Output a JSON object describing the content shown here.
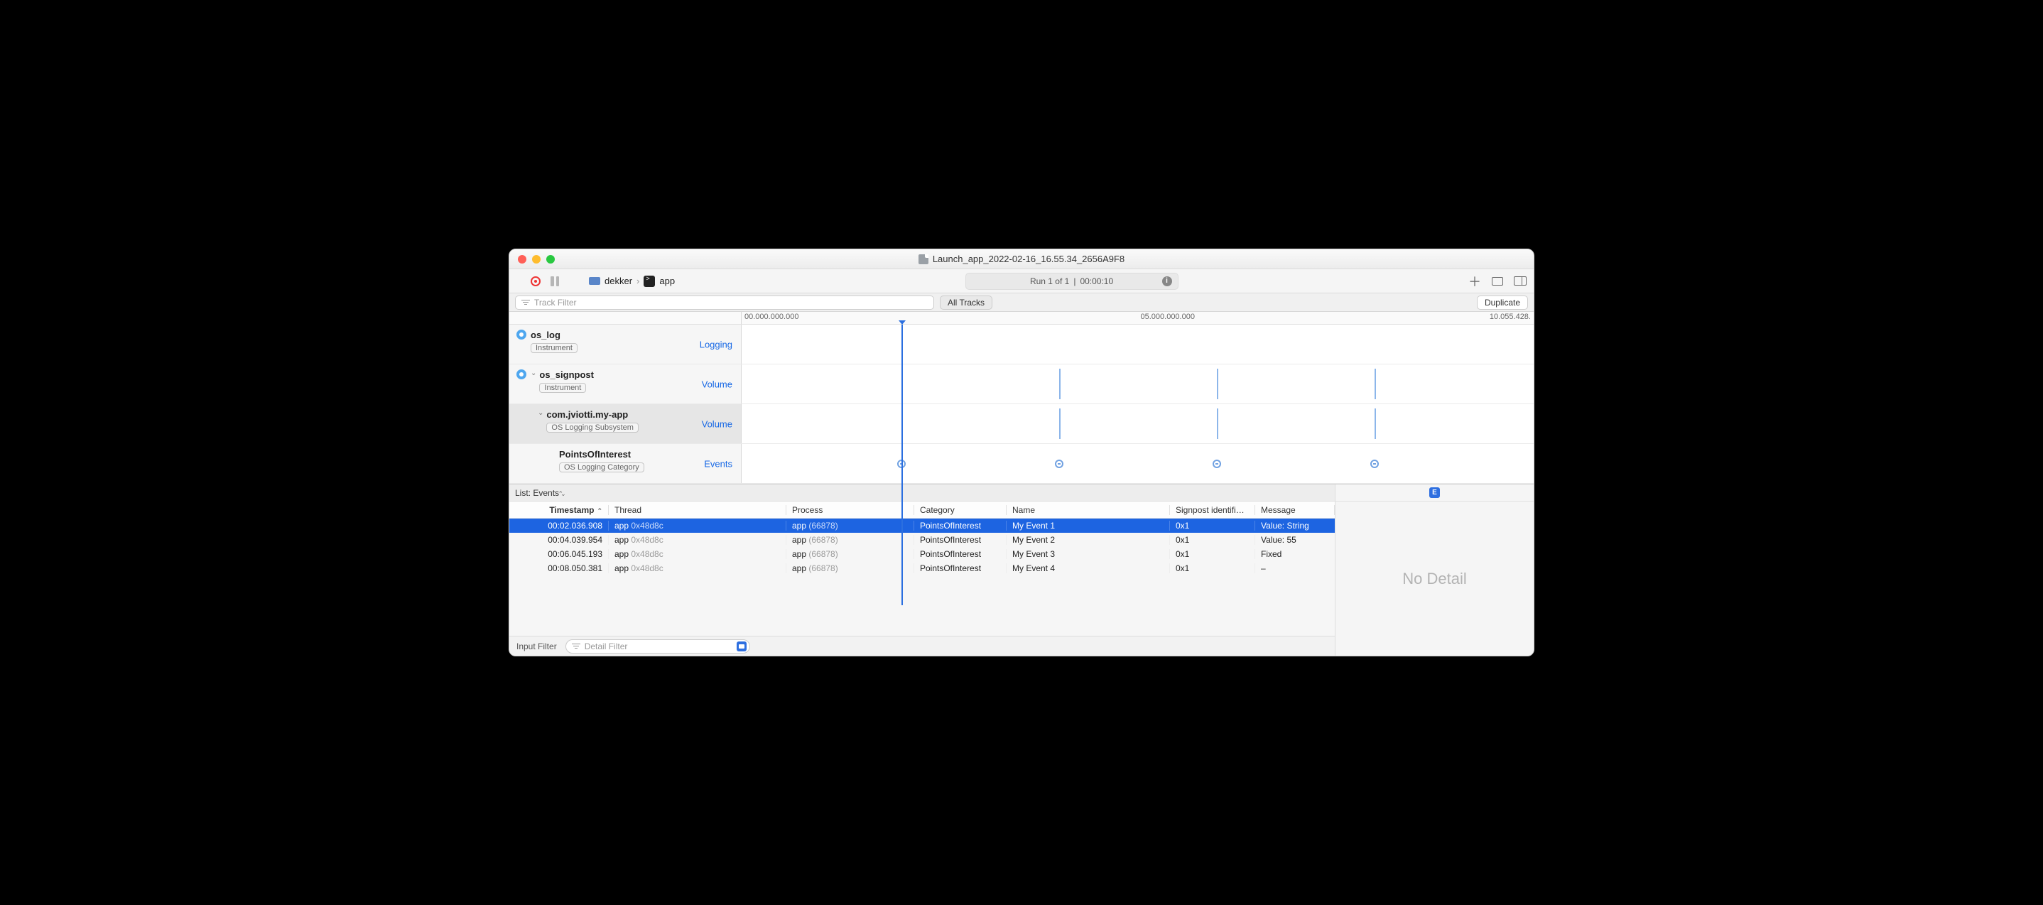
{
  "window": {
    "title": "Launch_app_2022-02-16_16.55.34_2656A9F8"
  },
  "toolbar": {
    "device": "dekker",
    "target": "app",
    "run_label": "Run 1 of 1",
    "run_time": "00:00:10"
  },
  "filterbar": {
    "track_filter_placeholder": "Track Filter",
    "all_tracks": "All Tracks",
    "duplicate": "Duplicate"
  },
  "ruler": {
    "t0": "00.000.000.000",
    "t5": "05.000.000.000",
    "t10": "10.055.428."
  },
  "tracks": {
    "os_log": {
      "title": "os_log",
      "tag": "Instrument",
      "metric": "Logging"
    },
    "os_signpost": {
      "title": "os_signpost",
      "tag": "Instrument",
      "metric": "Volume"
    },
    "subsystem": {
      "title": "com.jviotti.my-app",
      "tag": "OS Logging Subsystem",
      "metric": "Volume"
    },
    "poi": {
      "title": "PointsOfInterest",
      "tag": "OS Logging Category",
      "metric": "Events"
    }
  },
  "list": {
    "popup": "List: Events",
    "columns": {
      "timestamp": "Timestamp",
      "thread": "Thread",
      "process": "Process",
      "category": "Category",
      "name": "Name",
      "signpost": "Signpost identifi…",
      "message": "Message"
    },
    "rows": [
      {
        "ts": "00:02.036.908",
        "thread_a": "app",
        "thread_b": "0x48d8c",
        "proc_a": "app",
        "proc_b": "(66878)",
        "cat": "PointsOfInterest",
        "name": "My Event 1",
        "sig": "0x1",
        "msg": "Value: String"
      },
      {
        "ts": "00:04.039.954",
        "thread_a": "app",
        "thread_b": "0x48d8c",
        "proc_a": "app",
        "proc_b": "(66878)",
        "cat": "PointsOfInterest",
        "name": "My Event 2",
        "sig": "0x1",
        "msg": "Value: 55"
      },
      {
        "ts": "00:06.045.193",
        "thread_a": "app",
        "thread_b": "0x48d8c",
        "proc_a": "app",
        "proc_b": "(66878)",
        "cat": "PointsOfInterest",
        "name": "My Event 3",
        "sig": "0x1",
        "msg": "Fixed"
      },
      {
        "ts": "00:08.050.381",
        "thread_a": "app",
        "thread_b": "0x48d8c",
        "proc_a": "app",
        "proc_b": "(66878)",
        "cat": "PointsOfInterest",
        "name": "My Event 4",
        "sig": "0x1",
        "msg": "–"
      }
    ]
  },
  "detail": {
    "no_detail": "No Detail",
    "badge": "E"
  },
  "footer": {
    "input_filter": "Input Filter",
    "detail_filter_placeholder": "Detail Filter"
  },
  "event_positions_pct": [
    20.2,
    40.1,
    60.0,
    79.9
  ]
}
